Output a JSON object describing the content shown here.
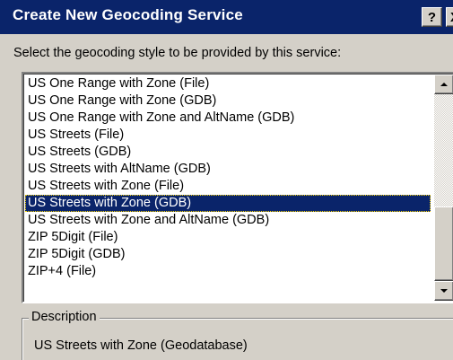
{
  "window": {
    "title": "Create New Geocoding Service",
    "help_label": "?",
    "close_label": "X"
  },
  "instruction": "Select the geocoding style to be provided by this service:",
  "styles": {
    "items": [
      "US One Range with Zone (File)",
      "US One Range with Zone (GDB)",
      "US One Range with Zone and AltName (GDB)",
      "US Streets (File)",
      "US Streets (GDB)",
      "US Streets with AltName (GDB)",
      "US Streets with Zone (File)",
      "US Streets with Zone (GDB)",
      "US Streets with Zone and AltName (GDB)",
      "ZIP 5Digit (File)",
      "ZIP 5Digit (GDB)",
      "ZIP+4 (File)"
    ],
    "selected": "US Streets with Zone (GDB)"
  },
  "description": {
    "label": "Description",
    "text": "US Streets with Zone (Geodatabase)"
  },
  "colors": {
    "title_bar": "#0a246a",
    "selection": "#0a246a",
    "face": "#d4d0c8"
  }
}
